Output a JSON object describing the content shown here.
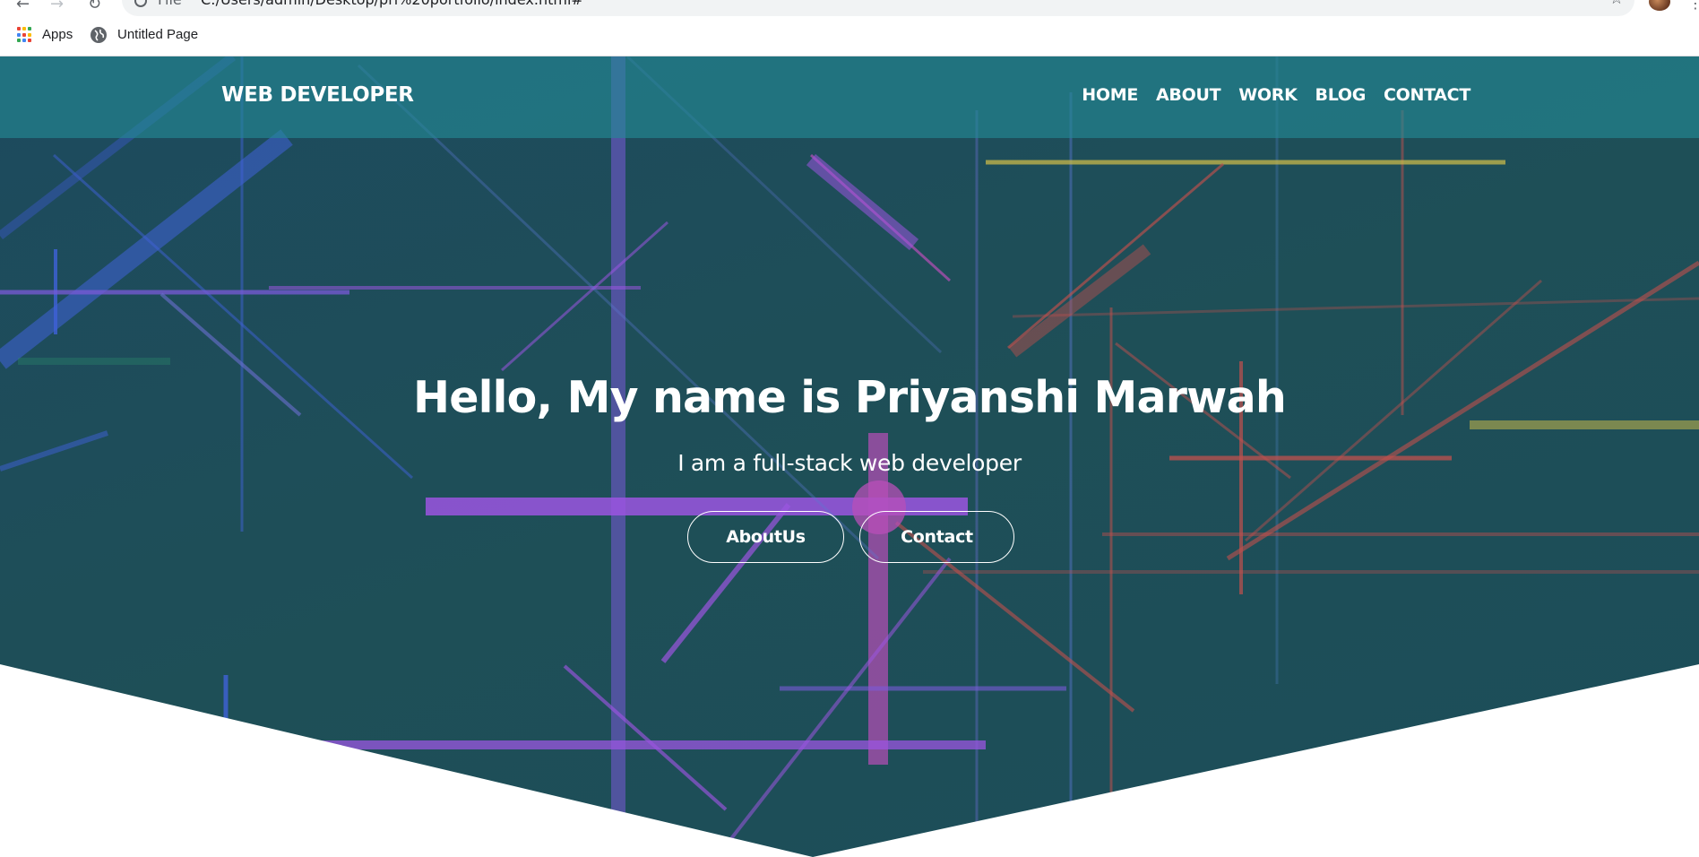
{
  "browser": {
    "file_label": "File",
    "url": "C:/Users/admin/Desktop/pri%20portfolio/index.html#",
    "icons": [
      "back-icon",
      "forward-icon",
      "reload-icon",
      "info-icon",
      "star-icon",
      "avatar",
      "menu-icon"
    ]
  },
  "bookmarks": [
    {
      "label": "Apps",
      "icon": "apps-grid-icon"
    },
    {
      "label": "Untitled Page",
      "icon": "globe-icon"
    }
  ],
  "site": {
    "brand": "WEB DEVELOPER",
    "nav": [
      "HOME",
      "ABOUT",
      "WORK",
      "BLOG",
      "CONTACT"
    ],
    "headline": "Hello, My name is Priyanshi Marwah",
    "subheadline": "I am a full-stack web developer",
    "buttons": {
      "about": "AboutUs",
      "contact": "Contact"
    }
  },
  "colors": {
    "hero_bg": "#1e4f57",
    "nav_overlay": "#248a96",
    "text": "#ffffff",
    "line_purple": "#9b55e0",
    "line_blue": "#3f62d8",
    "line_red": "#c0504d",
    "line_yellow": "#c8b84a"
  }
}
